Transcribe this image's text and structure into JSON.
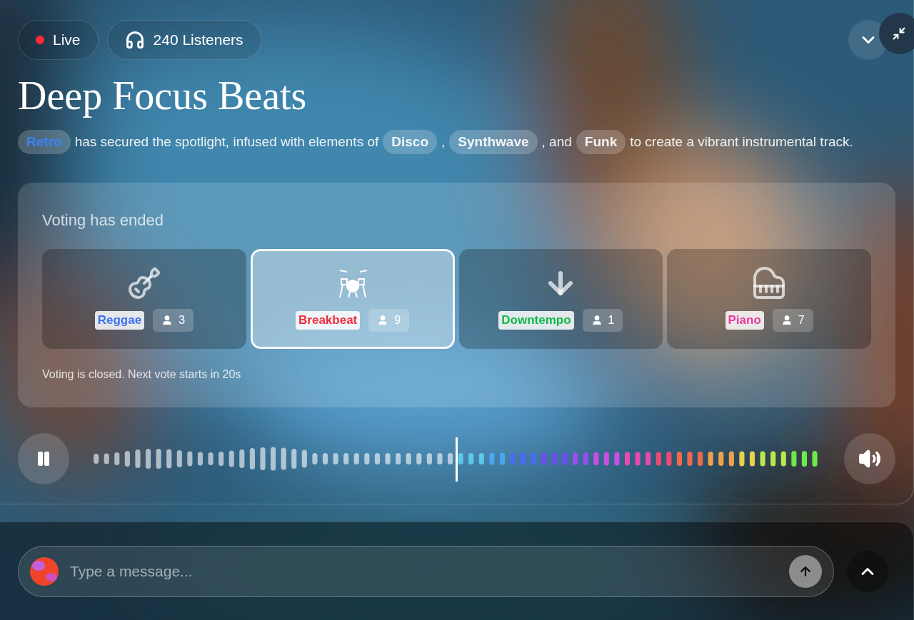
{
  "status": {
    "live_label": "Live",
    "listeners": "240 Listeners"
  },
  "title": "Deep Focus Beats",
  "description": [
    {
      "kind": "tag",
      "text": "Retro",
      "highlighted": true
    },
    {
      "kind": "text",
      "text": "has secured the spotlight, infused with elements of"
    },
    {
      "kind": "tag",
      "text": "Disco",
      "highlighted": false
    },
    {
      "kind": "text",
      "text": ","
    },
    {
      "kind": "tag",
      "text": "Synthwave",
      "highlighted": false
    },
    {
      "kind": "text",
      "text": ", and"
    },
    {
      "kind": "tag",
      "text": "Funk",
      "highlighted": false
    },
    {
      "kind": "text",
      "text": "to create a vibrant instrumental track."
    }
  ],
  "voting": {
    "heading": "Voting has ended",
    "options": [
      {
        "kind": "guitar",
        "label": "Reggae",
        "color": "#3b6ff5",
        "votes": "3",
        "selected": false
      },
      {
        "kind": "drums",
        "label": "Breakbeat",
        "color": "#ef2b3a",
        "votes": "9",
        "selected": true
      },
      {
        "kind": "arrow",
        "label": "Downtempo",
        "color": "#10b848",
        "votes": "1",
        "selected": false
      },
      {
        "kind": "piano",
        "label": "Piano",
        "color": "#ec3a9e",
        "votes": "7",
        "selected": false
      }
    ],
    "note": "Voting is closed. Next vote starts in 20s"
  },
  "player": {
    "playing": true,
    "level": 0.5
  },
  "message": {
    "placeholder": "Type a message..."
  }
}
